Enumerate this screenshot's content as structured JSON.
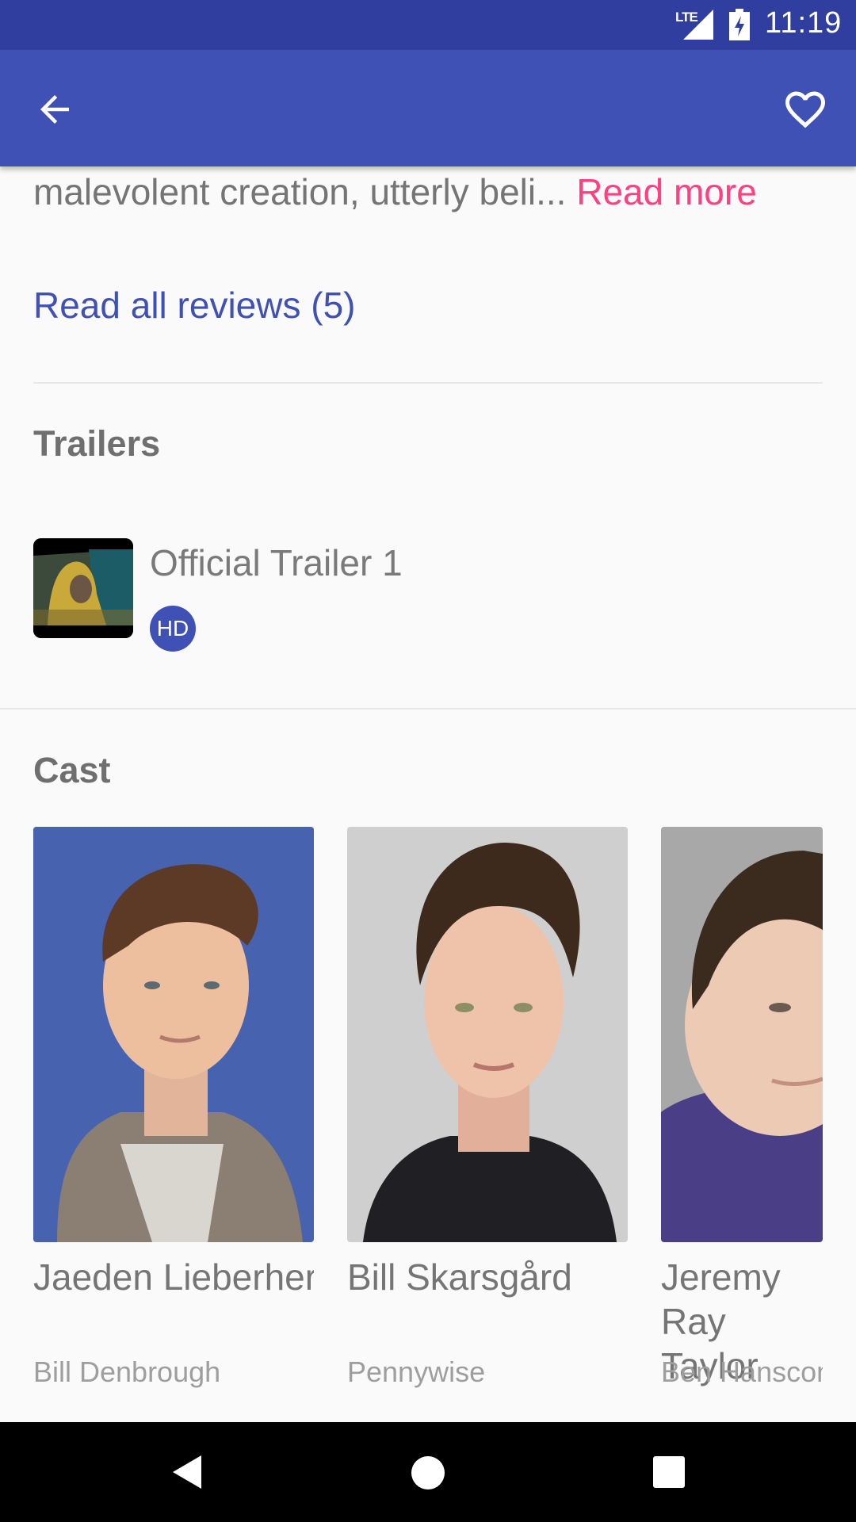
{
  "status_bar": {
    "network": "LTE",
    "time": "11:19"
  },
  "app_bar": {
    "back_icon": "arrow-left-icon",
    "favorite_icon": "heart-outline-icon"
  },
  "overview": {
    "clipped_text": "malevolent creation, utterly beli...",
    "read_more_label": "Read more"
  },
  "reviews": {
    "link_label": "Read all reviews (5)"
  },
  "trailers": {
    "section_title": "Trailers",
    "items": [
      {
        "title": "Official Trailer 1",
        "badge": "HD"
      }
    ]
  },
  "cast": {
    "section_title": "Cast",
    "items": [
      {
        "name": "Jaeden Lieberher",
        "role": "Bill Denbrough"
      },
      {
        "name": "Bill Skarsgård",
        "role": "Pennywise"
      },
      {
        "name": "Jeremy Ray\nTaylor",
        "role": "Ben Hanscom"
      }
    ]
  },
  "nav_bar": {
    "back_icon": "triangle-back-icon",
    "home_icon": "circle-home-icon",
    "recents_icon": "square-recents-icon"
  },
  "colors": {
    "primary": "#3f51b5",
    "primary_dark": "#303f9f",
    "accent": "#ff4081"
  }
}
